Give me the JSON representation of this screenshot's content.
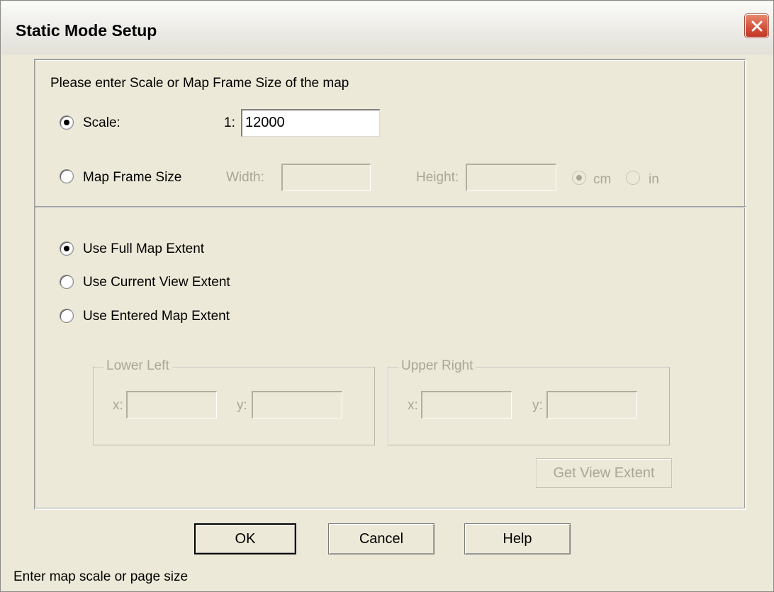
{
  "window": {
    "title": "Static Mode Setup"
  },
  "scale_section": {
    "prompt": "Please enter Scale or Map Frame Size of the map",
    "scale_label": "Scale:",
    "scale_prefix": "1:",
    "scale_value": "12000",
    "frame_label": "Map Frame Size",
    "width_label": "Width:",
    "width_value": "",
    "height_label": "Height:",
    "height_value": "",
    "unit_cm": "cm",
    "unit_in": "in"
  },
  "extent_section": {
    "full_label": "Use Full Map Extent",
    "current_label": "Use Current View Extent",
    "entered_label": "Use Entered Map Extent",
    "lower_left": {
      "title": "Lower Left",
      "x_label": "x:",
      "y_label": "y:",
      "x_value": "",
      "y_value": ""
    },
    "upper_right": {
      "title": "Upper Right",
      "x_label": "x:",
      "y_label": "y:",
      "x_value": "",
      "y_value": ""
    },
    "get_view_label": "Get View Extent"
  },
  "buttons": {
    "ok": "OK",
    "cancel": "Cancel",
    "help": "Help"
  },
  "status_text": "Enter map scale or page size"
}
